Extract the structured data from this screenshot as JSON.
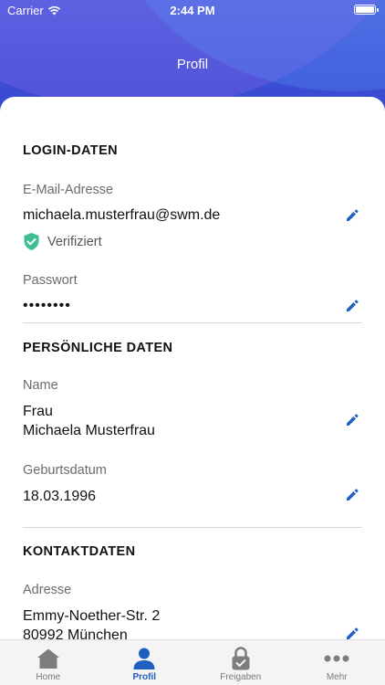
{
  "status_bar": {
    "carrier": "Carrier",
    "time": "2:44 PM"
  },
  "nav": {
    "title": "Profil"
  },
  "login": {
    "section_title": "LOGIN-DATEN",
    "email_label": "E-Mail-Adresse",
    "email_value": "michaela.musterfrau@swm.de",
    "verified_label": "Verifiziert",
    "password_label": "Passwort",
    "password_value": "••••••••"
  },
  "personal": {
    "section_title": "PERSÖNLICHE DATEN",
    "name_label": "Name",
    "salutation": "Frau",
    "name_value": "Michaela Musterfrau",
    "birthdate_label": "Geburtsdatum",
    "birthdate_value": "18.03.1996"
  },
  "contact": {
    "section_title": "KONTAKTDATEN",
    "address_label": "Adresse",
    "street": "Emmy-Noether-Str. 2",
    "city": "80992 München"
  },
  "tabs": [
    {
      "label": "Home",
      "icon": "home-icon"
    },
    {
      "label": "Profil",
      "icon": "profile-icon",
      "active": true
    },
    {
      "label": "Freigaben",
      "icon": "lock-icon"
    },
    {
      "label": "Mehr",
      "icon": "more-icon"
    }
  ],
  "colors": {
    "accent": "#1f5fc0",
    "verified": "#3dbf8f",
    "header": "#3d4fd6"
  }
}
